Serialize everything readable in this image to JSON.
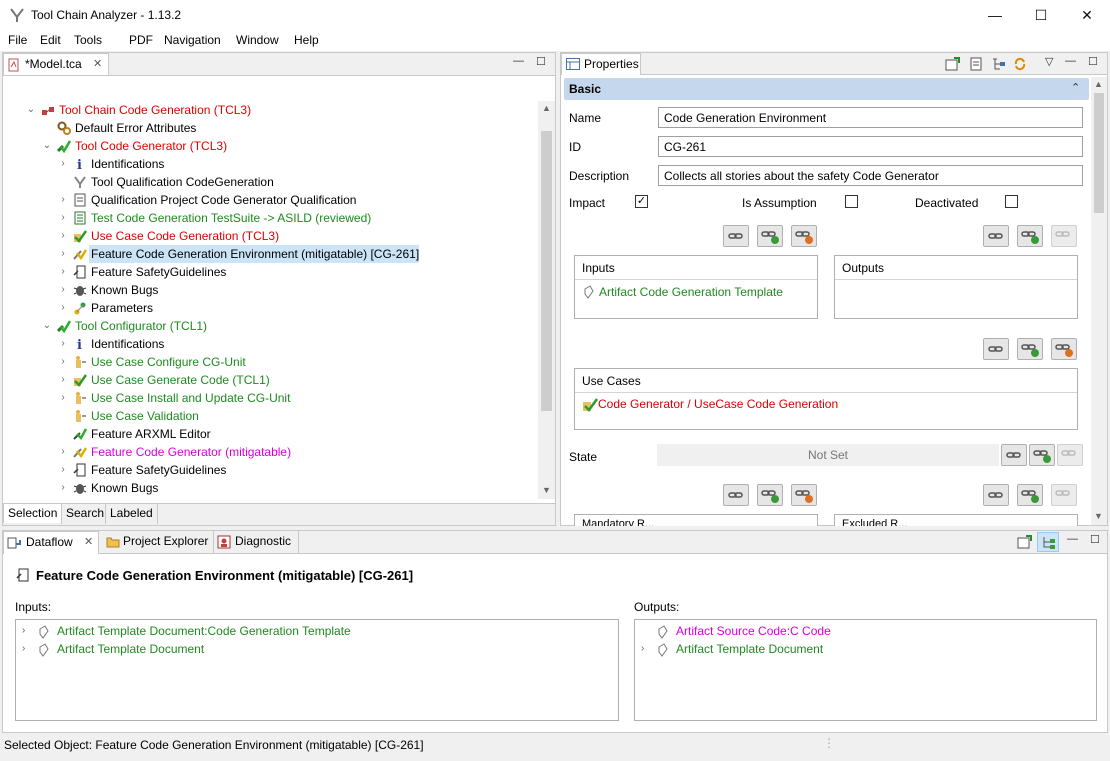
{
  "window": {
    "title": "Tool Chain Analyzer - 1.13.2",
    "minimize": "—",
    "maximize": "☐",
    "close": "✕"
  },
  "menu": [
    "File",
    "Edit",
    "Tools",
    "PDF",
    "Navigation",
    "Window",
    "Help"
  ],
  "editor": {
    "tab_label": "*Model.tca",
    "bottom_tabs": [
      "Selection",
      "Search",
      "Labeled"
    ],
    "tree": [
      {
        "label": "Tool Chain Code Generation (TCL3)",
        "color": "red",
        "icon": "toolchain-icon",
        "indent": 0,
        "chev": "down"
      },
      {
        "label": "Default Error Attributes",
        "color": "black",
        "icon": "gears-icon",
        "indent": 1,
        "chev": ""
      },
      {
        "label": "Tool Code Generator (TCL3)",
        "color": "red",
        "icon": "tool-check-icon",
        "indent": 1,
        "chev": "down"
      },
      {
        "label": "Identifications",
        "color": "black",
        "icon": "info-icon",
        "indent": 2,
        "chev": "right"
      },
      {
        "label": "Tool Qualification CodeGeneration",
        "color": "black",
        "icon": "qualification-icon",
        "indent": 2,
        "chev": ""
      },
      {
        "label": "Qualification Project Code Generator Qualification",
        "color": "black",
        "icon": "project-icon",
        "indent": 2,
        "chev": "right"
      },
      {
        "label": "Test Code Generation TestSuite -> ASILD (reviewed)",
        "color": "green",
        "icon": "testsuite-icon",
        "indent": 2,
        "chev": "right"
      },
      {
        "label": "Use Case Code Generation (TCL3)",
        "color": "red",
        "icon": "usecase-check-icon",
        "indent": 2,
        "chev": "right"
      },
      {
        "label": "Feature Code Generation Environment (mitigatable) [CG-261]",
        "color": "black",
        "icon": "feature-icon",
        "indent": 2,
        "chev": "right",
        "selected": true
      },
      {
        "label": "Feature SafetyGuidelines",
        "color": "black",
        "icon": "guideline-icon",
        "indent": 2,
        "chev": "right"
      },
      {
        "label": "Known Bugs",
        "color": "black",
        "icon": "bug-icon",
        "indent": 2,
        "chev": "right"
      },
      {
        "label": "Parameters",
        "color": "black",
        "icon": "parameters-icon",
        "indent": 2,
        "chev": "right"
      },
      {
        "label": "Tool Configurator (TCL1)",
        "color": "green",
        "icon": "tool-check-icon",
        "indent": 1,
        "chev": "down"
      },
      {
        "label": "Identifications",
        "color": "black",
        "icon": "info-icon",
        "indent": 2,
        "chev": "right"
      },
      {
        "label": "Use Case Configure CG-Unit",
        "color": "green",
        "icon": "usecase-icon",
        "indent": 2,
        "chev": "right"
      },
      {
        "label": "Use Case Generate Code (TCL1)",
        "color": "green",
        "icon": "usecase-check-icon",
        "indent": 2,
        "chev": "right"
      },
      {
        "label": "Use Case Install and Update CG-Unit",
        "color": "green",
        "icon": "usecase-icon",
        "indent": 2,
        "chev": "right"
      },
      {
        "label": "Use Case Validation",
        "color": "green",
        "icon": "usecase-icon",
        "indent": 2,
        "chev": ""
      },
      {
        "label": "Feature ARXML Editor",
        "color": "black",
        "icon": "feature-check-icon",
        "indent": 2,
        "chev": ""
      },
      {
        "label": "Feature Code Generator (mitigatable)",
        "color": "magenta",
        "icon": "feature-icon",
        "indent": 2,
        "chev": "right"
      },
      {
        "label": "Feature SafetyGuidelines",
        "color": "black",
        "icon": "guideline-icon",
        "indent": 2,
        "chev": "right"
      },
      {
        "label": "Known Bugs",
        "color": "black",
        "icon": "bug-icon",
        "indent": 2,
        "chev": "right"
      }
    ]
  },
  "properties": {
    "tab_label": "Properties",
    "section": "Basic",
    "name_label": "Name",
    "name_value": "Code Generation Environment",
    "id_label": "ID",
    "id_value": "CG-261",
    "desc_label": "Description",
    "desc_value": "Collects all stories about the safety Code Generator",
    "impact_label": "Impact",
    "assumption_label": "Is Assumption",
    "deactivated_label": "Deactivated",
    "inputs_label": "Inputs",
    "input_item": "Artifact Code Generation Template",
    "outputs_label": "Outputs",
    "usecases_label": "Use Cases",
    "usecase_item": "Code Generator / UseCase Code Generation",
    "state_label": "State",
    "state_value": "Not Set",
    "partial_left": "Mandatory R...",
    "partial_right": "Excluded R..."
  },
  "dataflow": {
    "tabs": [
      "Dataflow",
      "Project Explorer",
      "Diagnostic"
    ],
    "heading": "Feature Code Generation Environment (mitigatable) [CG-261]",
    "inputs_label": "Inputs:",
    "outputs_label": "Outputs:",
    "inputs": [
      "Artifact Template Document:Code Generation Template",
      "Artifact Template Document"
    ],
    "outputs": [
      {
        "label": "Artifact Source Code:C Code",
        "color": "magenta"
      },
      {
        "label": "Artifact Template Document",
        "color": "green"
      }
    ]
  },
  "status": {
    "text": "Selected Object: Feature Code Generation Environment (mitigatable) [CG-261]"
  },
  "colors": {
    "accent": "#cce4f7",
    "section_header": "#c5d7ec",
    "red": "#e00000",
    "green": "#1f8a1f",
    "magenta": "#d800d8"
  }
}
